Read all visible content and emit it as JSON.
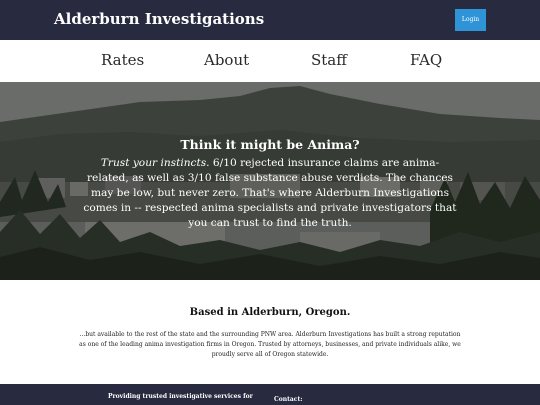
{
  "header": {
    "brand": "Alderburn Investigations",
    "login_label": "Login"
  },
  "nav": {
    "items": [
      {
        "label": "Rates"
      },
      {
        "label": "About"
      },
      {
        "label": "Staff"
      },
      {
        "label": "FAQ"
      }
    ]
  },
  "hero": {
    "title": "Think it might be Anima?",
    "lead": "Trust your instincts.",
    "body": " 6/10 rejected insurance claims are anima-related, as well as 3/10 false substance abuse verdicts. The chances may be low, but never zero. That's where Alderburn Investigations comes in -- respected anima specialists and private investigators that you can trust to find the truth."
  },
  "about": {
    "title": "Based in Alderburn, Oregon.",
    "body": "...but available to the rest of the state and the surrounding PNW area. Alderburn Investigations has built a strong reputation as one of the leading anima investigation firms in Oregon. Trusted by attorneys, businesses, and private individuals alike, we proudly serve all of Oregon statewide."
  },
  "footer": {
    "tagline": "Providing trusted investigative services for",
    "contact_label": "Contact:"
  },
  "colors": {
    "topbar": "#282b3f",
    "login_button": "#2f93d8",
    "footer": "#282b3f"
  }
}
